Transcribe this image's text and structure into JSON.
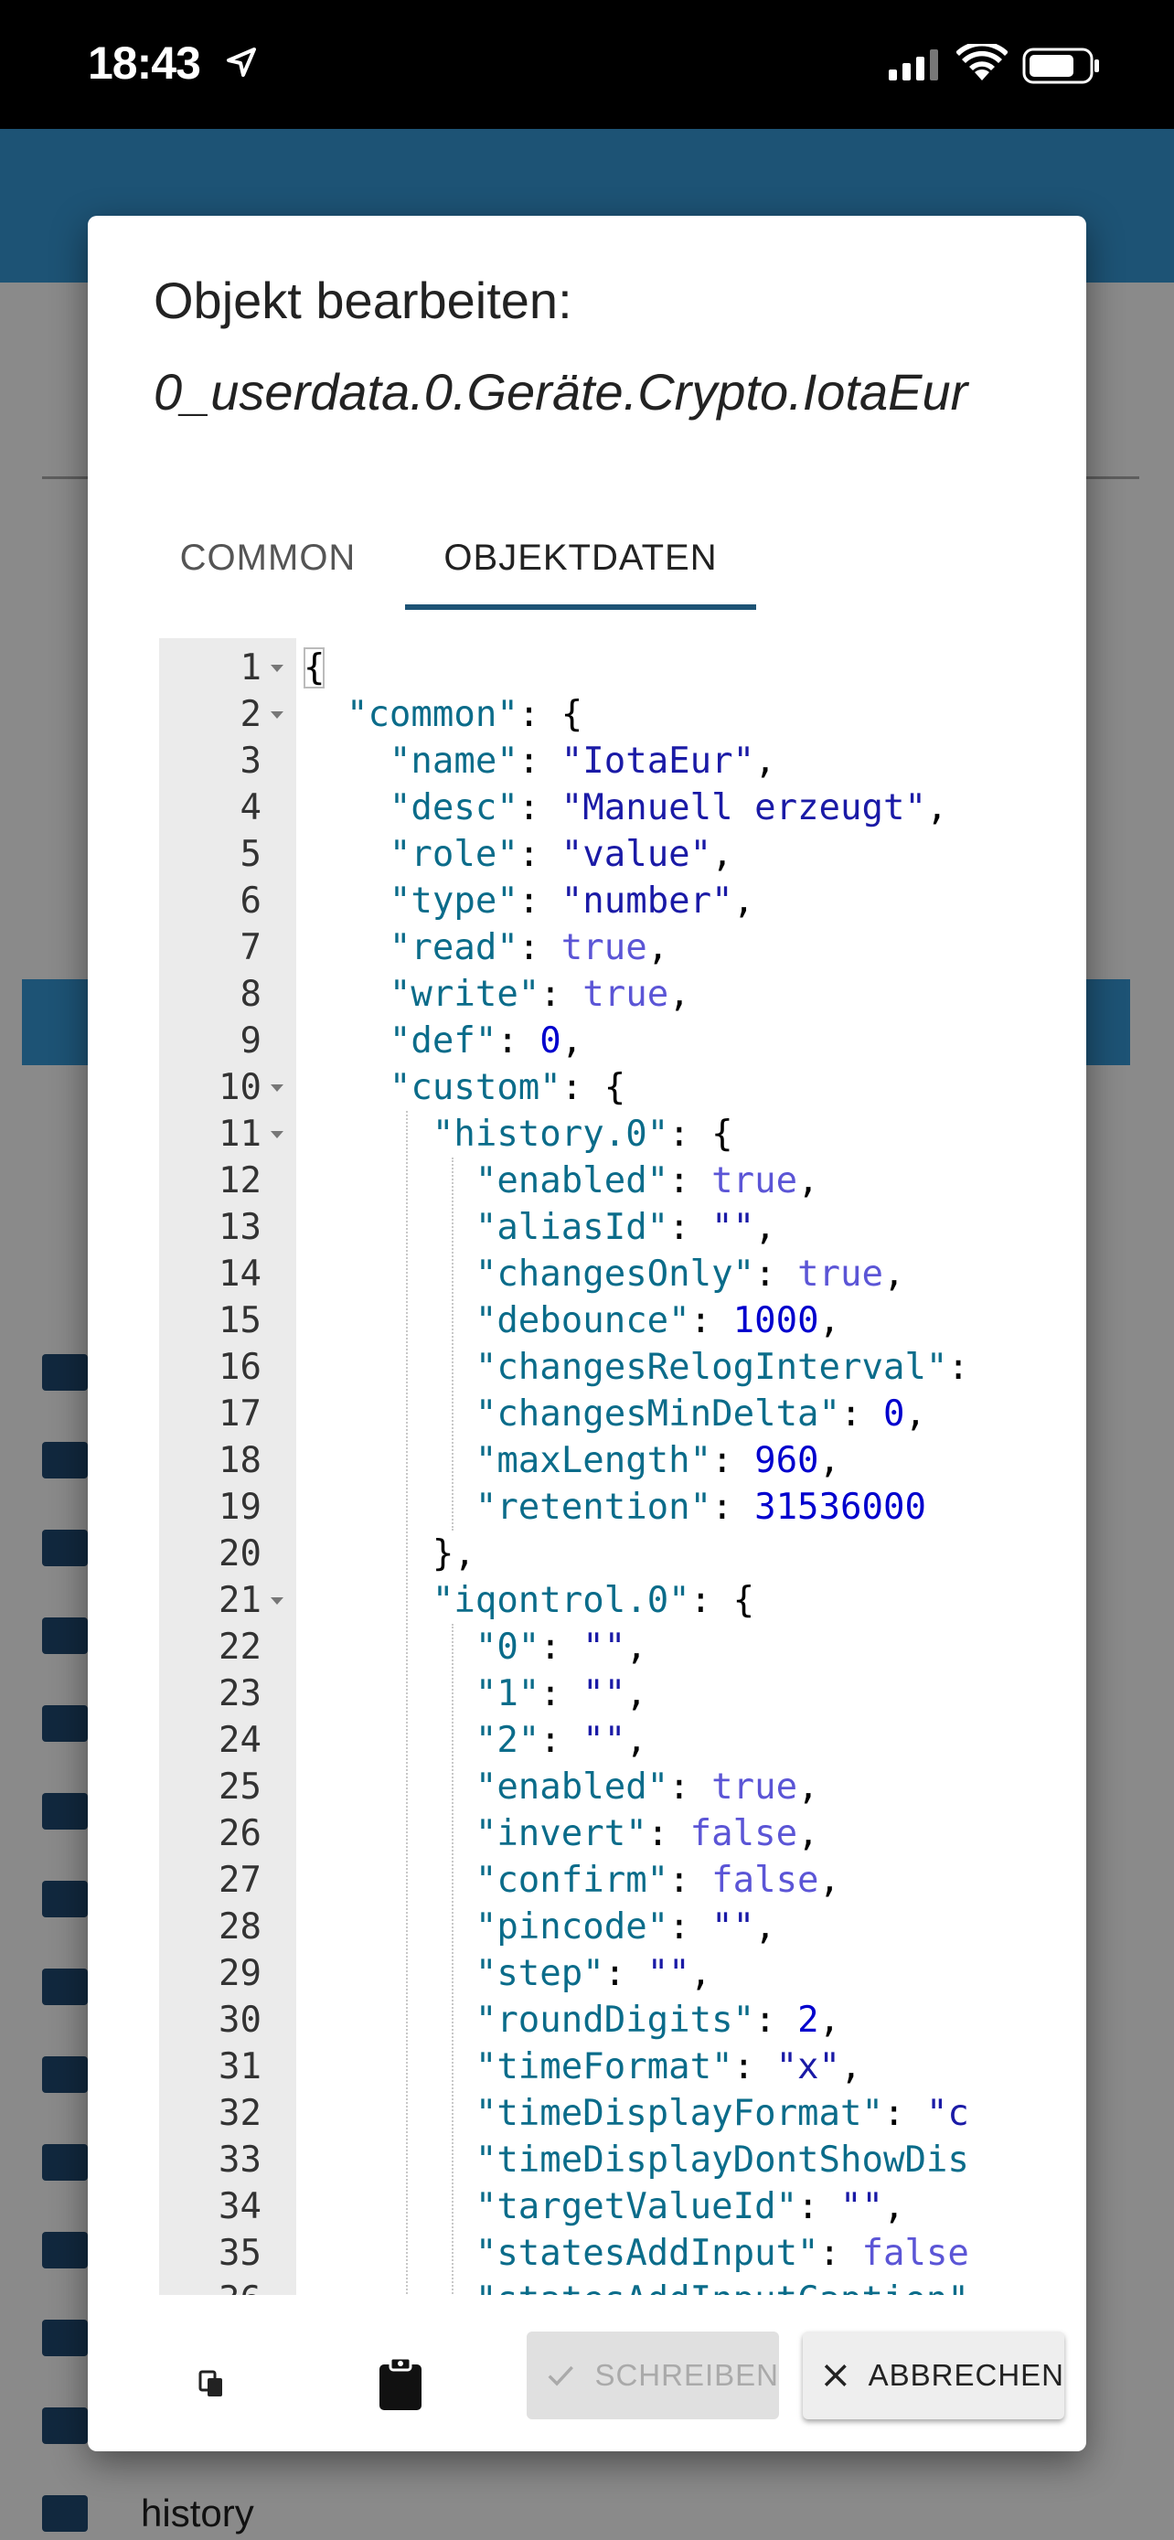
{
  "status_bar": {
    "time": "18:43"
  },
  "background": {
    "history_label": "history"
  },
  "dialog": {
    "title": "Objekt bearbeiten:",
    "object_id": "0_userdata.0.Geräte.Crypto.IotaEur",
    "tabs": [
      {
        "label": "COMMON",
        "active": false
      },
      {
        "label": "OBJEKTDATEN",
        "active": true
      }
    ],
    "buttons": {
      "write": "SCHREIBEN",
      "cancel": "ABBRECHEN"
    },
    "icons": {
      "copy": "copy-icon",
      "paste": "clipboard-icon",
      "write": "check-icon",
      "cancel": "close-icon"
    },
    "accent_color": "#1d5375"
  },
  "editor": {
    "lines": [
      {
        "n": "1",
        "fold": true,
        "tokens": [
          [
            "p",
            "{"
          ]
        ]
      },
      {
        "n": "2",
        "fold": true,
        "tokens": [
          [
            "p",
            "  "
          ],
          [
            "k",
            "\"common\""
          ],
          [
            "p",
            ": {"
          ]
        ]
      },
      {
        "n": "3",
        "fold": false,
        "tokens": [
          [
            "p",
            "    "
          ],
          [
            "k",
            "\"name\""
          ],
          [
            "p",
            ": "
          ],
          [
            "s",
            "\"IotaEur\""
          ],
          [
            "p",
            ","
          ]
        ]
      },
      {
        "n": "4",
        "fold": false,
        "tokens": [
          [
            "p",
            "    "
          ],
          [
            "k",
            "\"desc\""
          ],
          [
            "p",
            ": "
          ],
          [
            "s",
            "\"Manuell erzeugt\""
          ],
          [
            "p",
            ","
          ]
        ]
      },
      {
        "n": "5",
        "fold": false,
        "tokens": [
          [
            "p",
            "    "
          ],
          [
            "k",
            "\"role\""
          ],
          [
            "p",
            ": "
          ],
          [
            "s",
            "\"value\""
          ],
          [
            "p",
            ","
          ]
        ]
      },
      {
        "n": "6",
        "fold": false,
        "tokens": [
          [
            "p",
            "    "
          ],
          [
            "k",
            "\"type\""
          ],
          [
            "p",
            ": "
          ],
          [
            "s",
            "\"number\""
          ],
          [
            "p",
            ","
          ]
        ]
      },
      {
        "n": "7",
        "fold": false,
        "tokens": [
          [
            "p",
            "    "
          ],
          [
            "k",
            "\"read\""
          ],
          [
            "p",
            ": "
          ],
          [
            "b",
            "true"
          ],
          [
            "p",
            ","
          ]
        ]
      },
      {
        "n": "8",
        "fold": false,
        "tokens": [
          [
            "p",
            "    "
          ],
          [
            "k",
            "\"write\""
          ],
          [
            "p",
            ": "
          ],
          [
            "b",
            "true"
          ],
          [
            "p",
            ","
          ]
        ]
      },
      {
        "n": "9",
        "fold": false,
        "tokens": [
          [
            "p",
            "    "
          ],
          [
            "k",
            "\"def\""
          ],
          [
            "p",
            ": "
          ],
          [
            "n",
            "0"
          ],
          [
            "p",
            ","
          ]
        ]
      },
      {
        "n": "10",
        "fold": true,
        "tokens": [
          [
            "p",
            "    "
          ],
          [
            "k",
            "\"custom\""
          ],
          [
            "p",
            ": {"
          ]
        ]
      },
      {
        "n": "11",
        "fold": true,
        "tokens": [
          [
            "p",
            "      "
          ],
          [
            "k",
            "\"history.0\""
          ],
          [
            "p",
            ": {"
          ]
        ]
      },
      {
        "n": "12",
        "fold": false,
        "tokens": [
          [
            "p",
            "        "
          ],
          [
            "k",
            "\"enabled\""
          ],
          [
            "p",
            ": "
          ],
          [
            "b",
            "true"
          ],
          [
            "p",
            ","
          ]
        ]
      },
      {
        "n": "13",
        "fold": false,
        "tokens": [
          [
            "p",
            "        "
          ],
          [
            "k",
            "\"aliasId\""
          ],
          [
            "p",
            ": "
          ],
          [
            "s",
            "\"\""
          ],
          [
            "p",
            ","
          ]
        ]
      },
      {
        "n": "14",
        "fold": false,
        "tokens": [
          [
            "p",
            "        "
          ],
          [
            "k",
            "\"changesOnly\""
          ],
          [
            "p",
            ": "
          ],
          [
            "b",
            "true"
          ],
          [
            "p",
            ","
          ]
        ]
      },
      {
        "n": "15",
        "fold": false,
        "tokens": [
          [
            "p",
            "        "
          ],
          [
            "k",
            "\"debounce\""
          ],
          [
            "p",
            ": "
          ],
          [
            "n",
            "1000"
          ],
          [
            "p",
            ","
          ]
        ]
      },
      {
        "n": "16",
        "fold": false,
        "tokens": [
          [
            "p",
            "        "
          ],
          [
            "k",
            "\"changesRelogInterval\""
          ],
          [
            "p",
            ":"
          ]
        ]
      },
      {
        "n": "17",
        "fold": false,
        "tokens": [
          [
            "p",
            "        "
          ],
          [
            "k",
            "\"changesMinDelta\""
          ],
          [
            "p",
            ": "
          ],
          [
            "n",
            "0"
          ],
          [
            "p",
            ","
          ]
        ]
      },
      {
        "n": "18",
        "fold": false,
        "tokens": [
          [
            "p",
            "        "
          ],
          [
            "k",
            "\"maxLength\""
          ],
          [
            "p",
            ": "
          ],
          [
            "n",
            "960"
          ],
          [
            "p",
            ","
          ]
        ]
      },
      {
        "n": "19",
        "fold": false,
        "tokens": [
          [
            "p",
            "        "
          ],
          [
            "k",
            "\"retention\""
          ],
          [
            "p",
            ": "
          ],
          [
            "n",
            "31536000"
          ]
        ]
      },
      {
        "n": "20",
        "fold": false,
        "tokens": [
          [
            "p",
            "      },"
          ]
        ]
      },
      {
        "n": "21",
        "fold": true,
        "tokens": [
          [
            "p",
            "      "
          ],
          [
            "k",
            "\"iqontrol.0\""
          ],
          [
            "p",
            ": {"
          ]
        ]
      },
      {
        "n": "22",
        "fold": false,
        "tokens": [
          [
            "p",
            "        "
          ],
          [
            "k",
            "\"0\""
          ],
          [
            "p",
            ": "
          ],
          [
            "s",
            "\"\""
          ],
          [
            "p",
            ","
          ]
        ]
      },
      {
        "n": "23",
        "fold": false,
        "tokens": [
          [
            "p",
            "        "
          ],
          [
            "k",
            "\"1\""
          ],
          [
            "p",
            ": "
          ],
          [
            "s",
            "\"\""
          ],
          [
            "p",
            ","
          ]
        ]
      },
      {
        "n": "24",
        "fold": false,
        "tokens": [
          [
            "p",
            "        "
          ],
          [
            "k",
            "\"2\""
          ],
          [
            "p",
            ": "
          ],
          [
            "s",
            "\"\""
          ],
          [
            "p",
            ","
          ]
        ]
      },
      {
        "n": "25",
        "fold": false,
        "tokens": [
          [
            "p",
            "        "
          ],
          [
            "k",
            "\"enabled\""
          ],
          [
            "p",
            ": "
          ],
          [
            "b",
            "true"
          ],
          [
            "p",
            ","
          ]
        ]
      },
      {
        "n": "26",
        "fold": false,
        "tokens": [
          [
            "p",
            "        "
          ],
          [
            "k",
            "\"invert\""
          ],
          [
            "p",
            ": "
          ],
          [
            "b",
            "false"
          ],
          [
            "p",
            ","
          ]
        ]
      },
      {
        "n": "27",
        "fold": false,
        "tokens": [
          [
            "p",
            "        "
          ],
          [
            "k",
            "\"confirm\""
          ],
          [
            "p",
            ": "
          ],
          [
            "b",
            "false"
          ],
          [
            "p",
            ","
          ]
        ]
      },
      {
        "n": "28",
        "fold": false,
        "tokens": [
          [
            "p",
            "        "
          ],
          [
            "k",
            "\"pincode\""
          ],
          [
            "p",
            ": "
          ],
          [
            "s",
            "\"\""
          ],
          [
            "p",
            ","
          ]
        ]
      },
      {
        "n": "29",
        "fold": false,
        "tokens": [
          [
            "p",
            "        "
          ],
          [
            "k",
            "\"step\""
          ],
          [
            "p",
            ": "
          ],
          [
            "s",
            "\"\""
          ],
          [
            "p",
            ","
          ]
        ]
      },
      {
        "n": "30",
        "fold": false,
        "tokens": [
          [
            "p",
            "        "
          ],
          [
            "k",
            "\"roundDigits\""
          ],
          [
            "p",
            ": "
          ],
          [
            "n",
            "2"
          ],
          [
            "p",
            ","
          ]
        ]
      },
      {
        "n": "31",
        "fold": false,
        "tokens": [
          [
            "p",
            "        "
          ],
          [
            "k",
            "\"timeFormat\""
          ],
          [
            "p",
            ": "
          ],
          [
            "s",
            "\"x\""
          ],
          [
            "p",
            ","
          ]
        ]
      },
      {
        "n": "32",
        "fold": false,
        "tokens": [
          [
            "p",
            "        "
          ],
          [
            "k",
            "\"timeDisplayFormat\""
          ],
          [
            "p",
            ": "
          ],
          [
            "s",
            "\"c"
          ]
        ]
      },
      {
        "n": "33",
        "fold": false,
        "tokens": [
          [
            "p",
            "        "
          ],
          [
            "k",
            "\"timeDisplayDontShowDis"
          ]
        ]
      },
      {
        "n": "34",
        "fold": false,
        "tokens": [
          [
            "p",
            "        "
          ],
          [
            "k",
            "\"targetValueId\""
          ],
          [
            "p",
            ": "
          ],
          [
            "s",
            "\"\""
          ],
          [
            "p",
            ","
          ]
        ]
      },
      {
        "n": "35",
        "fold": false,
        "tokens": [
          [
            "p",
            "        "
          ],
          [
            "k",
            "\"statesAddInput\""
          ],
          [
            "p",
            ": "
          ],
          [
            "b",
            "false"
          ]
        ]
      },
      {
        "n": "36",
        "fold": false,
        "tokens": [
          [
            "p",
            "        "
          ],
          [
            "k",
            "\"statesAddInputCaption\""
          ]
        ]
      }
    ]
  }
}
